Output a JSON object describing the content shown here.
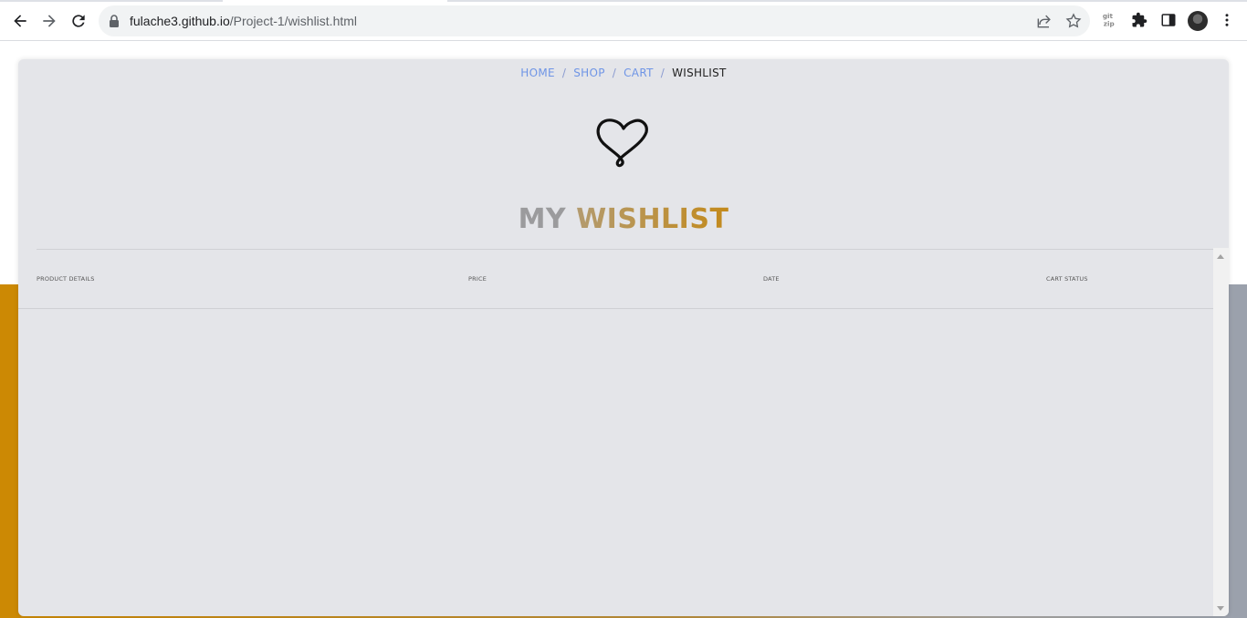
{
  "browser": {
    "url_host": "fulache3.github.io",
    "url_path": "/Project-1/wishlist.html",
    "icons": [
      "back-icon",
      "forward-icon",
      "reload-icon",
      "lock-icon",
      "share-icon",
      "bookmark-star-icon",
      "extension-gitzip-icon",
      "extensions-puzzle-icon",
      "side-panel-icon",
      "profile-avatar",
      "menu-kebab-icon"
    ]
  },
  "breadcrumb": {
    "home": "HOME",
    "shop": "SHOP",
    "cart": "CART",
    "current": "WISHLIST",
    "separator": "/"
  },
  "page": {
    "title_part1": "MY ",
    "title_part2": "WISHLIST",
    "icon": "heart-icon"
  },
  "table": {
    "columns": [
      "PRODUCT DETAILS",
      "PRICE",
      "DATE",
      "CART STATUS"
    ],
    "rows": []
  },
  "colors": {
    "accent_gold": "#cc8904",
    "link_blue": "#6f95e6",
    "card_bg": "#e4e5e9",
    "title_grey": "#9b9b9d"
  }
}
